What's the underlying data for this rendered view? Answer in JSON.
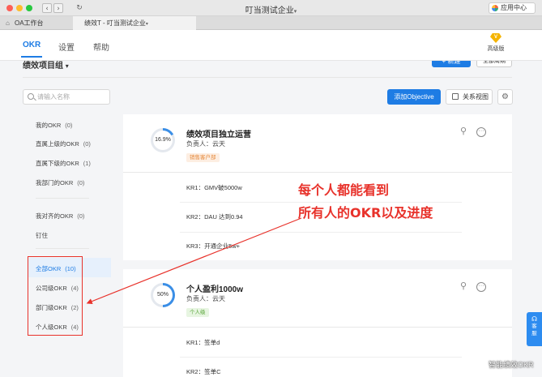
{
  "window": {
    "title": "叮当测试企业",
    "title_caret": "▾",
    "app_center": "应用中心",
    "back": "‹",
    "forward": "›",
    "reload": "↻"
  },
  "tabs": [
    {
      "label": "OA工作台",
      "icon": "home-icon"
    },
    {
      "label": "绩效T - 叮当测试企业",
      "suffix": "▾",
      "active": true
    }
  ],
  "header": {
    "menus": [
      "OKR",
      "设置",
      "帮助"
    ],
    "upgrade_label": "高级版",
    "upgrade_badge": "V"
  },
  "toolbar": {
    "group_title": "绩效项目组",
    "group_caret": "▾",
    "new_button": "+ 新建",
    "period_button": "全部周期",
    "search_placeholder": "请输入名称",
    "add_objective": "添加Objective",
    "relation_view": "关系视图",
    "settings": "⚙"
  },
  "sidebar": {
    "items": [
      {
        "label": "我的OKR",
        "count": "(0)"
      },
      {
        "label": "直属上级的OKR",
        "count": "(0)"
      },
      {
        "label": "直属下级的OKR",
        "count": "(1)"
      },
      {
        "label": "我部门的OKR",
        "count": "(0)"
      },
      {
        "label": "我对齐的OKR",
        "count": "(0)"
      },
      {
        "label": "钉住",
        "count": ""
      },
      {
        "label": "全部OKR",
        "count": "(10)",
        "active": true
      },
      {
        "label": "公司级OKR",
        "count": "(4)"
      },
      {
        "label": "部门级OKR",
        "count": "(2)"
      },
      {
        "label": "个人级OKR",
        "count": "(4)"
      }
    ]
  },
  "objectives": [
    {
      "title": "绩效项目独立运营",
      "progress_label": "16.9%",
      "progress": 0.169,
      "owner": "负责人：云天",
      "tag": "销售客户部",
      "krs": [
        "KR1：GMV破5000w",
        "KR2：DAU 达到0.94",
        "KR3：开通企业5w+"
      ]
    },
    {
      "title": "个人盈利1000w",
      "progress_label": "50%",
      "progress": 0.5,
      "owner": "负责人：云天",
      "tag": "个人级",
      "krs": [
        "KR1：签单d",
        "KR2：签单C"
      ]
    }
  ],
  "callout": {
    "line1": "每个人都能看到",
    "line2": "所有人的OKR以及进度",
    "color": "#e8322b"
  },
  "customer_service": {
    "label": "客服"
  },
  "watermark": "智能绩效OKR",
  "colors": {
    "accent": "#1e7ce4",
    "annotation": "#e8322b",
    "ring": "#3a8ee6"
  }
}
